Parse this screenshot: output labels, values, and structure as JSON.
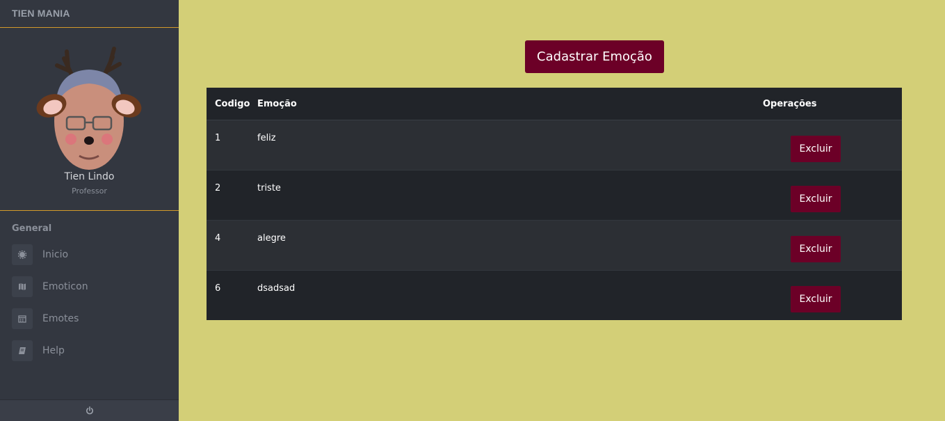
{
  "sidebar": {
    "brand": "TIEN MANIA",
    "user": {
      "name": "Tien Lindo",
      "role": "Professor"
    },
    "section_title": "General",
    "items": [
      {
        "label": "Inicio",
        "icon": "gear-icon"
      },
      {
        "label": "Emoticon",
        "icon": "map-icon"
      },
      {
        "label": "Emotes",
        "icon": "calendar-icon"
      },
      {
        "label": "Help",
        "icon": "book-icon"
      }
    ],
    "footer_icon": "power-icon"
  },
  "main": {
    "add_button_label": "Cadastrar Emoção",
    "table": {
      "headers": [
        "Codigo",
        "Emoção",
        "Operações"
      ],
      "rows": [
        {
          "codigo": "1",
          "emocao": "feliz",
          "action": "Excluir"
        },
        {
          "codigo": "2",
          "emocao": "triste",
          "action": "Excluir"
        },
        {
          "codigo": "4",
          "emocao": "alegre",
          "action": "Excluir"
        },
        {
          "codigo": "6",
          "emocao": "dsadsad",
          "action": "Excluir"
        }
      ]
    }
  },
  "colors": {
    "background": "#d3cf77",
    "sidebar": "#333740",
    "accent_line": "#d39a2a",
    "button": "#6c0027",
    "table_dark": "#212429",
    "table_light": "#2c2f34"
  }
}
